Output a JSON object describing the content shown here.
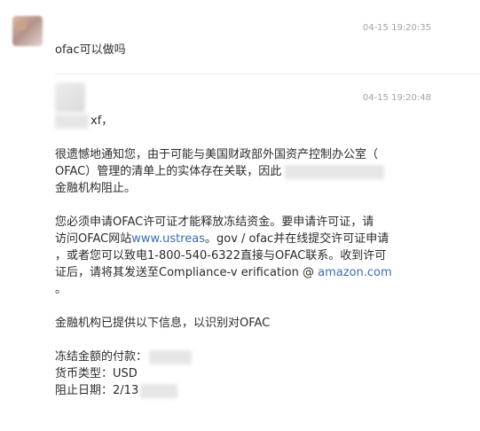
{
  "messages": [
    {
      "time": "04-15 19:20:35",
      "text": "ofac可以做吗"
    },
    {
      "time": "04-15 19:20:48",
      "greeting_suffix": "xf，",
      "para1": {
        "line1": "很遗憾地通知您，由于可能与美国财政部外国资产控制办公室（",
        "line2": "OFAC）管理的清单上的实体存在关联，因此",
        "line3": "金融机构阻止。"
      },
      "para2": {
        "line1": "您必须申请OFAC许可证才能释放冻结资金。要申请许可证，请",
        "line2_prefix": "访问OFAC网站",
        "line2_link": "www.ustreas",
        "line2_suffix": "。gov / ofac并在线提交许可证申请",
        "line3": "，或者您可以致电1-800-540-6322直接与OFAC联系。收到许可",
        "line4_prefix": "证后，请将其发送至Compliance-v erification @ ",
        "line4_link": "amazon.com",
        "line5": "。"
      },
      "para3": "金融机构已提供以下信息，以识别对OFAC",
      "details": {
        "amount_label": "冻结金额的付款：",
        "currency_label": "货币类型：",
        "currency_value": "USD",
        "date_label": "阻止日期：",
        "date_value": "2/13"
      }
    }
  ],
  "colors": {
    "text": "#2b2b2b",
    "timestamp": "#a3a3a3",
    "link": "#3b6db3",
    "divider": "#ebebeb"
  }
}
